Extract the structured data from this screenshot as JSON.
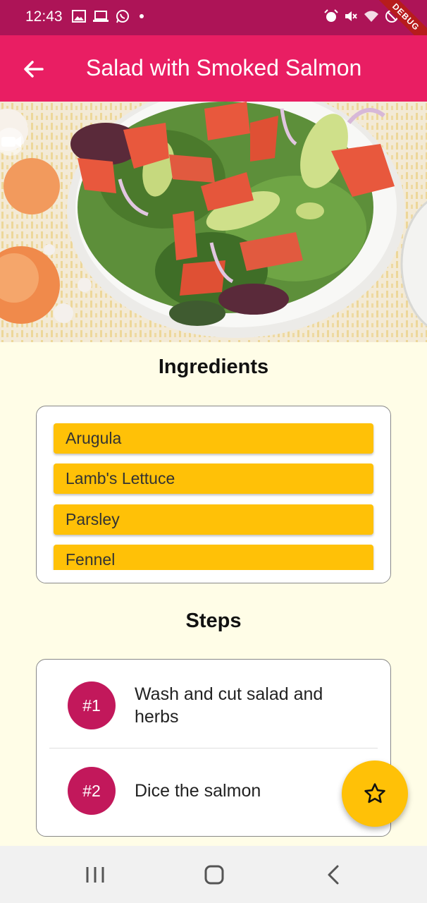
{
  "status_bar": {
    "time": "12:43",
    "debug_label": "DEBUG",
    "icons": [
      "gallery-icon",
      "laptop-icon",
      "whatsapp-icon",
      "dot-icon",
      "alarm-icon",
      "mute-icon",
      "wifi-icon",
      "no-sim-icon"
    ]
  },
  "app_bar": {
    "title": "Salad with Smoked Salmon",
    "back_icon": "arrow-left-icon"
  },
  "hero": {
    "icon": "video-icon"
  },
  "ingredients": {
    "title": "Ingredients",
    "items": [
      "Arugula",
      "Lamb's Lettuce",
      "Parsley",
      "Fennel"
    ]
  },
  "steps": {
    "title": "Steps",
    "items": [
      {
        "badge": "#1",
        "text": "Wash and cut salad and herbs"
      },
      {
        "badge": "#2",
        "text": "Dice the salmon"
      }
    ]
  },
  "fab": {
    "icon": "star-outline-icon"
  },
  "nav_bar": {
    "icons": [
      "recent-apps-icon",
      "home-icon",
      "back-icon"
    ]
  },
  "colors": {
    "status_bar": "#ad1457",
    "app_bar": "#e91e63",
    "background": "#fffde7",
    "ingredient_tile": "#ffc107",
    "step_badge": "#c2185b",
    "fab": "#ffc107"
  }
}
